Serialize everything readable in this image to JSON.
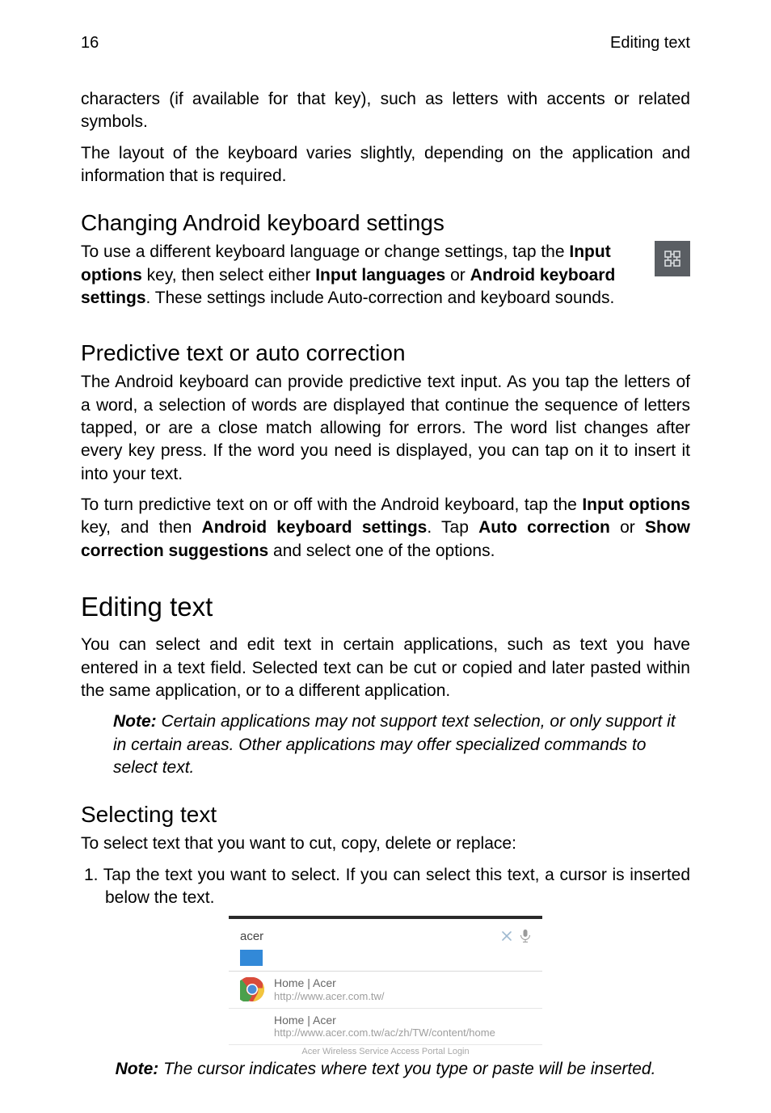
{
  "header": {
    "pageNumber": "16",
    "sectionTitle": "Editing text"
  },
  "intro": {
    "p1": "characters (if available for that key), such as letters with accents or related symbols.",
    "p2": "The layout of the keyboard varies slightly, depending on the application and information that is required."
  },
  "s1": {
    "title": "Changing Android keyboard settings",
    "p_a": "To use a different keyboard language or change settings, tap the ",
    "p_b": "Input options",
    "p_c": " key, then select either ",
    "p_d": "Input languages",
    "p_e": " or ",
    "p_f": "Android keyboard settings",
    "p_g": ". These settings include Auto-correction and keyboard sounds."
  },
  "s2": {
    "title": "Predictive text or auto correction",
    "p1": "The Android keyboard can provide predictive text input. As you tap the letters of a word, a selection of words are displayed that continue the sequence of letters tapped, or are a close match allowing for errors. The word list changes after every key press. If the word you need is displayed, you can tap on it to insert it into your text.",
    "p2_a": "To turn predictive text on or off with the Android keyboard, tap the ",
    "p2_b": "Input options",
    "p2_c": " key, and then ",
    "p2_d": "Android keyboard settings",
    "p2_e": ". Tap ",
    "p2_f": "Auto correction",
    "p2_g": " or ",
    "p2_h": "Show correction suggestions",
    "p2_i": " and select one of the options."
  },
  "s3": {
    "title": "Editing text",
    "p1": "You can select and edit text in certain applications, such as text you have entered in a text field. Selected text can be cut or copied and later pasted within the same application, or to a different application.",
    "note_label": "Note:",
    "note_body": " Certain applications may not support text selection, or only support it in certain areas. Other applications may offer specialized commands to select text."
  },
  "s4": {
    "title": "Selecting text",
    "p1": "To select text that you want to cut, copy, delete or replace:",
    "li1_prefix": "1. ",
    "li1": "Tap the text you want to select. If you can select this text, a cursor is inserted below the text."
  },
  "shot": {
    "searchValue": "acer",
    "item1_title": "Home | Acer",
    "item1_url": "http://www.acer.com.tw/",
    "item2_title": "Home | Acer",
    "item2_url": "http://www.acer.com.tw/ac/zh/TW/content/home",
    "item3_cut": "Acer Wireless Service Access Portal Login"
  },
  "note2": {
    "label": "Note:",
    "body": " The cursor indicates where text you type or paste will be inserted."
  },
  "icons": {
    "settings": "input-options-icon",
    "close": "close-icon",
    "mic": "mic-icon",
    "chrome": "chrome-icon"
  }
}
